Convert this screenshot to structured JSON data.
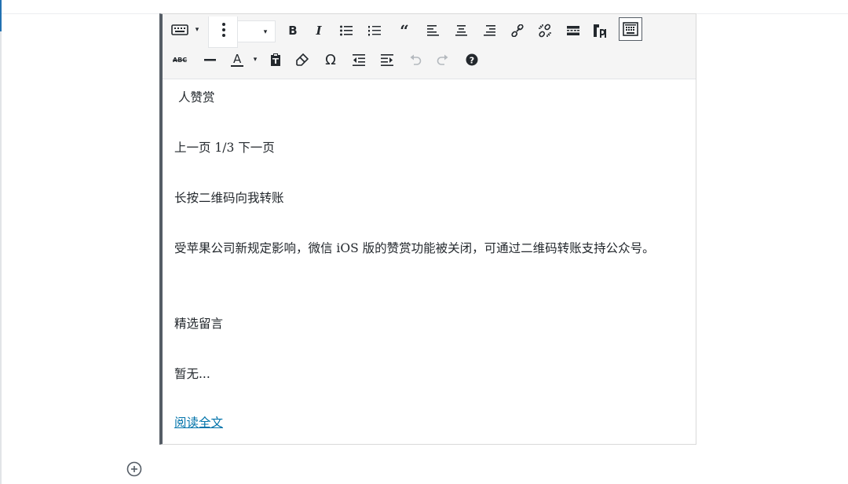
{
  "toolbar": {
    "row1": [
      {
        "name": "keyboard-mode-icon",
        "glyph": "⌨"
      },
      {
        "name": "more-options-icon",
        "glyph": "⋮"
      },
      {
        "name": "bold-icon",
        "glyph": "B"
      },
      {
        "name": "italic-icon",
        "glyph": "I"
      },
      {
        "name": "bulleted-list-icon",
        "glyph": "☰"
      },
      {
        "name": "numbered-list-icon",
        "glyph": "☷"
      },
      {
        "name": "blockquote-icon",
        "glyph": "❝"
      },
      {
        "name": "align-left-icon",
        "glyph": "≡"
      },
      {
        "name": "align-center-icon",
        "glyph": "≡"
      },
      {
        "name": "align-right-icon",
        "glyph": "≡"
      },
      {
        "name": "insert-link-icon",
        "glyph": "🔗"
      },
      {
        "name": "remove-link-icon",
        "glyph": "✂"
      },
      {
        "name": "insert-read-more-icon",
        "glyph": "▬"
      },
      {
        "name": "paste-as-text-icon",
        "glyph": "¶"
      },
      {
        "name": "toolbar-toggle-icon",
        "glyph": "▦"
      }
    ],
    "row2": [
      {
        "name": "strikethrough-icon",
        "glyph": "ABC"
      },
      {
        "name": "horizontal-line-icon",
        "glyph": "—"
      },
      {
        "name": "text-color-icon",
        "glyph": "A"
      },
      {
        "name": "paste-text-icon",
        "glyph": "📋"
      },
      {
        "name": "clear-formatting-icon",
        "glyph": "⌫"
      },
      {
        "name": "special-character-icon",
        "glyph": "Ω"
      },
      {
        "name": "decrease-indent-icon",
        "glyph": "⇤"
      },
      {
        "name": "increase-indent-icon",
        "glyph": "⇥"
      },
      {
        "name": "undo-icon",
        "glyph": "↶"
      },
      {
        "name": "redo-icon",
        "glyph": "↷"
      },
      {
        "name": "help-icon",
        "glyph": "?"
      }
    ],
    "dropdown_caret": "▾"
  },
  "content": {
    "line1": "人赞赏",
    "line2": "上一页 1/3 下一页",
    "line3": "长按二维码向我转账",
    "line4": "受苹果公司新规定影响，微信 iOS 版的赞赏功能被关闭，可通过二维码转账支持公众号。",
    "line5": "精选留言",
    "line6": "暂无...",
    "link": "阅读全文"
  },
  "add_block_icon": "plus-circle-icon"
}
